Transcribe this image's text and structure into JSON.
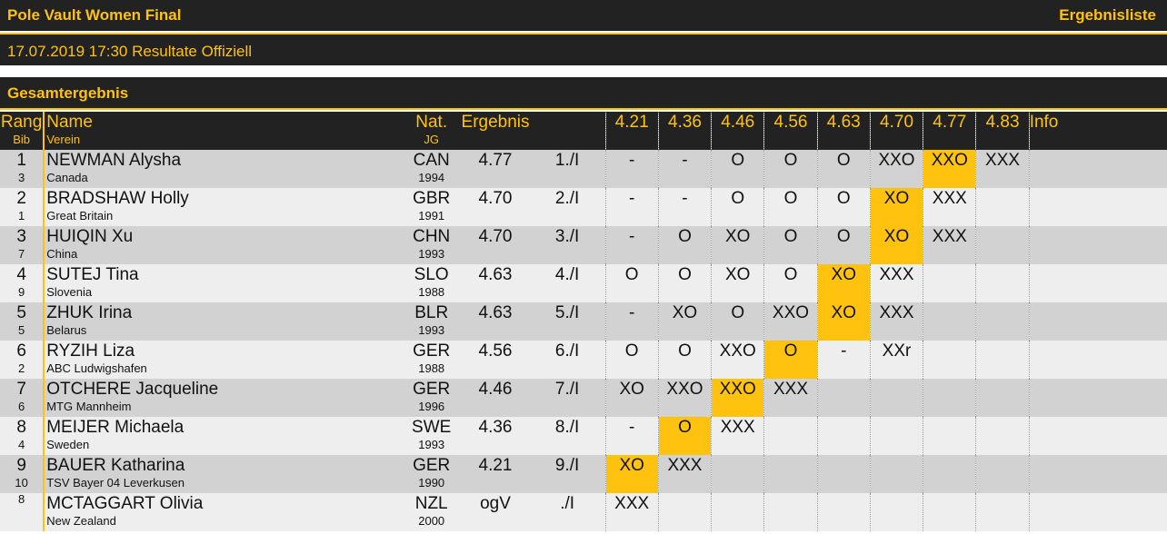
{
  "header": {
    "title": "Pole Vault Women Final",
    "list_type": "Ergebnisliste",
    "subtitle": "17.07.2019 17:30 Resultate Offiziell",
    "section": "Gesamtergebnis"
  },
  "colors": {
    "bar": "#222222",
    "accent": "#ffc20e",
    "row_odd": "#d2d2d2",
    "row_even": "#eeeeee"
  },
  "columns": {
    "rang": "Rang",
    "bib": "Bib",
    "name": "Name",
    "verein": "Verein",
    "nat": "Nat.",
    "jg": "JG",
    "ergebnis": "Ergebnis",
    "info": "Info",
    "heights": [
      "4.21",
      "4.36",
      "4.46",
      "4.56",
      "4.63",
      "4.70",
      "4.77",
      "4.83"
    ]
  },
  "athletes": [
    {
      "rang": "1",
      "bib": "3",
      "name": "NEWMAN Alysha",
      "club": "Canada",
      "nat": "CAN",
      "year": "1994",
      "result": "4.77",
      "place": "1./I",
      "attempts": [
        "-",
        "-",
        "O",
        "O",
        "O",
        "XXO",
        "XXO",
        "XXX"
      ],
      "best_index": 6,
      "info": ""
    },
    {
      "rang": "2",
      "bib": "1",
      "name": "BRADSHAW Holly",
      "club": "Great Britain",
      "nat": "GBR",
      "year": "1991",
      "result": "4.70",
      "place": "2./I",
      "attempts": [
        "-",
        "-",
        "O",
        "O",
        "O",
        "XO",
        "XXX",
        ""
      ],
      "best_index": 5,
      "info": ""
    },
    {
      "rang": "3",
      "bib": "7",
      "name": "HUIQIN Xu",
      "club": "China",
      "nat": "CHN",
      "year": "1993",
      "result": "4.70",
      "place": "3./I",
      "attempts": [
        "-",
        "O",
        "XO",
        "O",
        "O",
        "XO",
        "XXX",
        ""
      ],
      "best_index": 5,
      "info": ""
    },
    {
      "rang": "4",
      "bib": "9",
      "name": "SUTEJ Tina",
      "club": "Slovenia",
      "nat": "SLO",
      "year": "1988",
      "result": "4.63",
      "place": "4./I",
      "attempts": [
        "O",
        "O",
        "XO",
        "O",
        "XO",
        "XXX",
        "",
        ""
      ],
      "best_index": 4,
      "info": ""
    },
    {
      "rang": "5",
      "bib": "5",
      "name": "ZHUK Irina",
      "club": "Belarus",
      "nat": "BLR",
      "year": "1993",
      "result": "4.63",
      "place": "5./I",
      "attempts": [
        "-",
        "XO",
        "O",
        "XXO",
        "XO",
        "XXX",
        "",
        ""
      ],
      "best_index": 4,
      "info": ""
    },
    {
      "rang": "6",
      "bib": "2",
      "name": "RYZIH Liza",
      "club": "ABC Ludwigshafen",
      "nat": "GER",
      "year": "1988",
      "result": "4.56",
      "place": "6./I",
      "attempts": [
        "O",
        "O",
        "XXO",
        "O",
        "-",
        "XXr",
        "",
        ""
      ],
      "best_index": 3,
      "info": ""
    },
    {
      "rang": "7",
      "bib": "6",
      "name": "OTCHERE Jacqueline",
      "club": "MTG Mannheim",
      "nat": "GER",
      "year": "1996",
      "result": "4.46",
      "place": "7./I",
      "attempts": [
        "XO",
        "XXO",
        "XXO",
        "XXX",
        "",
        "",
        "",
        ""
      ],
      "best_index": 2,
      "info": ""
    },
    {
      "rang": "8",
      "bib": "4",
      "name": "MEIJER Michaela",
      "club": "Sweden",
      "nat": "SWE",
      "year": "1993",
      "result": "4.36",
      "place": "8./I",
      "attempts": [
        "-",
        "O",
        "XXX",
        "",
        "",
        "",
        "",
        ""
      ],
      "best_index": 1,
      "info": ""
    },
    {
      "rang": "9",
      "bib": "10",
      "name": "BAUER Katharina",
      "club": "TSV Bayer 04 Leverkusen",
      "nat": "GER",
      "year": "1990",
      "result": "4.21",
      "place": "9./I",
      "attempts": [
        "XO",
        "XXX",
        "",
        "",
        "",
        "",
        "",
        ""
      ],
      "best_index": 0,
      "info": ""
    },
    {
      "rang": "",
      "bib": "8",
      "name": "MCTAGGART Olivia",
      "club": "New Zealand",
      "nat": "NZL",
      "year": "2000",
      "result": "ogV",
      "place": "./I",
      "attempts": [
        "XXX",
        "",
        "",
        "",
        "",
        "",
        "",
        ""
      ],
      "best_index": -1,
      "info": ""
    }
  ]
}
